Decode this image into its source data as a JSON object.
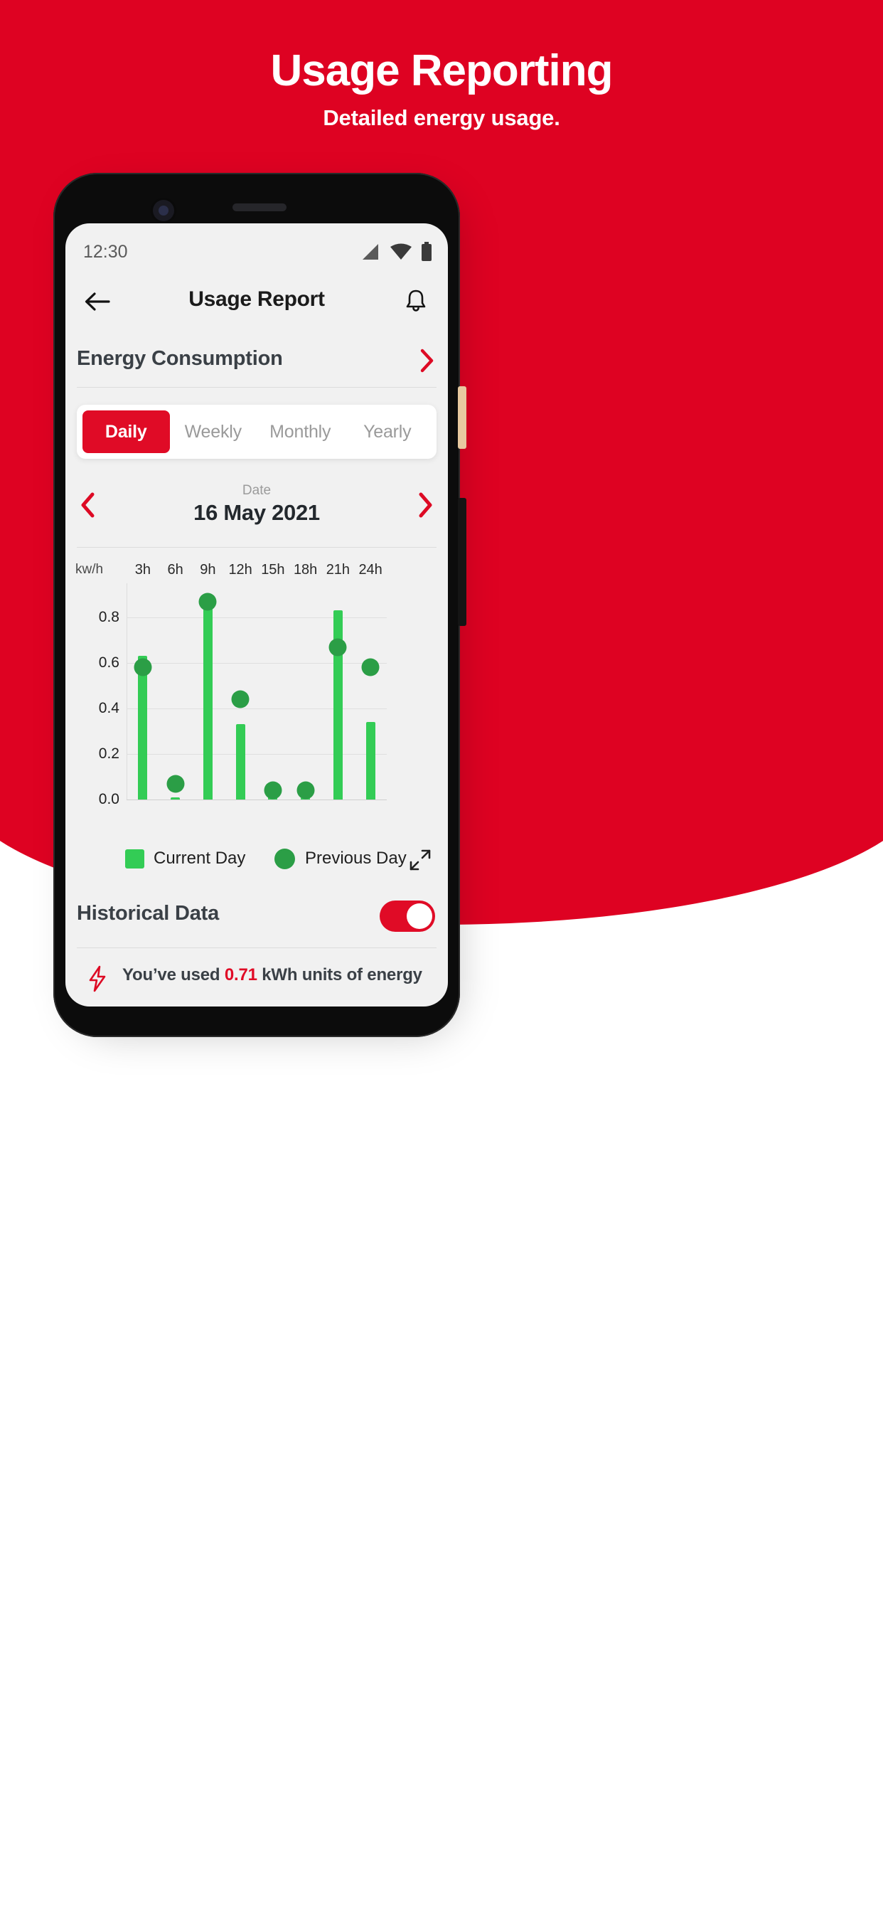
{
  "hero": {
    "title": "Usage Reporting",
    "subtitle": "Detailed energy usage.",
    "bg_color": "#DE0222"
  },
  "phone": {
    "statusbar": {
      "time": "12:30",
      "icons": [
        "signal-icon",
        "wifi-icon",
        "battery-icon"
      ]
    },
    "appbar": {
      "back_icon": "arrow-left-icon",
      "title": "Usage Report",
      "notification_icon": "bell-icon"
    },
    "energy_consumption": {
      "label": "Energy Consumption",
      "chevron_icon": "chevron-right-icon"
    },
    "tabs": {
      "items": [
        {
          "label": "Daily",
          "active": true
        },
        {
          "label": "Weekly",
          "active": false
        },
        {
          "label": "Monthly",
          "active": false
        },
        {
          "label": "Yearly",
          "active": false
        }
      ],
      "active_color": "#E00B26"
    },
    "date_nav": {
      "prev_icon": "chevron-left-icon",
      "next_icon": "chevron-right-icon",
      "caption": "Date",
      "value": "16 May 2021"
    },
    "legend": {
      "current_label": "Current Day",
      "current_color": "#33CC55",
      "previous_label": "Previous Day",
      "previous_color": "#2B9E46",
      "expand_icon": "expand-diagonal-icon"
    },
    "historical": {
      "label": "Historical Data",
      "toggle_on": true,
      "toggle_color": "#E00B26"
    },
    "footer": {
      "icon": "lightning-bolt-icon",
      "prefix": "You’ve used ",
      "amount": "0.71",
      "suffix": " kWh units of energy"
    }
  },
  "chart_data": {
    "type": "bar",
    "title": "",
    "xlabel": "",
    "ylabel": "kw/h",
    "unit_label": "kw/h",
    "categories": [
      "3h",
      "6h",
      "9h",
      "12h",
      "15h",
      "18h",
      "21h",
      "24h"
    ],
    "yticks": [
      "0.0",
      "0.2",
      "0.4",
      "0.6",
      "0.8"
    ],
    "ytick_values": [
      0.0,
      0.2,
      0.4,
      0.6,
      0.8
    ],
    "ylim": [
      0,
      0.95
    ],
    "grid": true,
    "legend_position": "bottom-left",
    "series": [
      {
        "name": "Current Day",
        "type": "bar",
        "color": "#33CC55",
        "values": [
          0.63,
          0.01,
          0.87,
          0.33,
          0.04,
          0.01,
          0.83,
          0.34
        ]
      },
      {
        "name": "Previous Day",
        "type": "scatter",
        "color": "#2B9E46",
        "values": [
          0.58,
          0.07,
          0.87,
          0.44,
          0.04,
          0.04,
          0.67,
          0.58
        ]
      }
    ]
  }
}
